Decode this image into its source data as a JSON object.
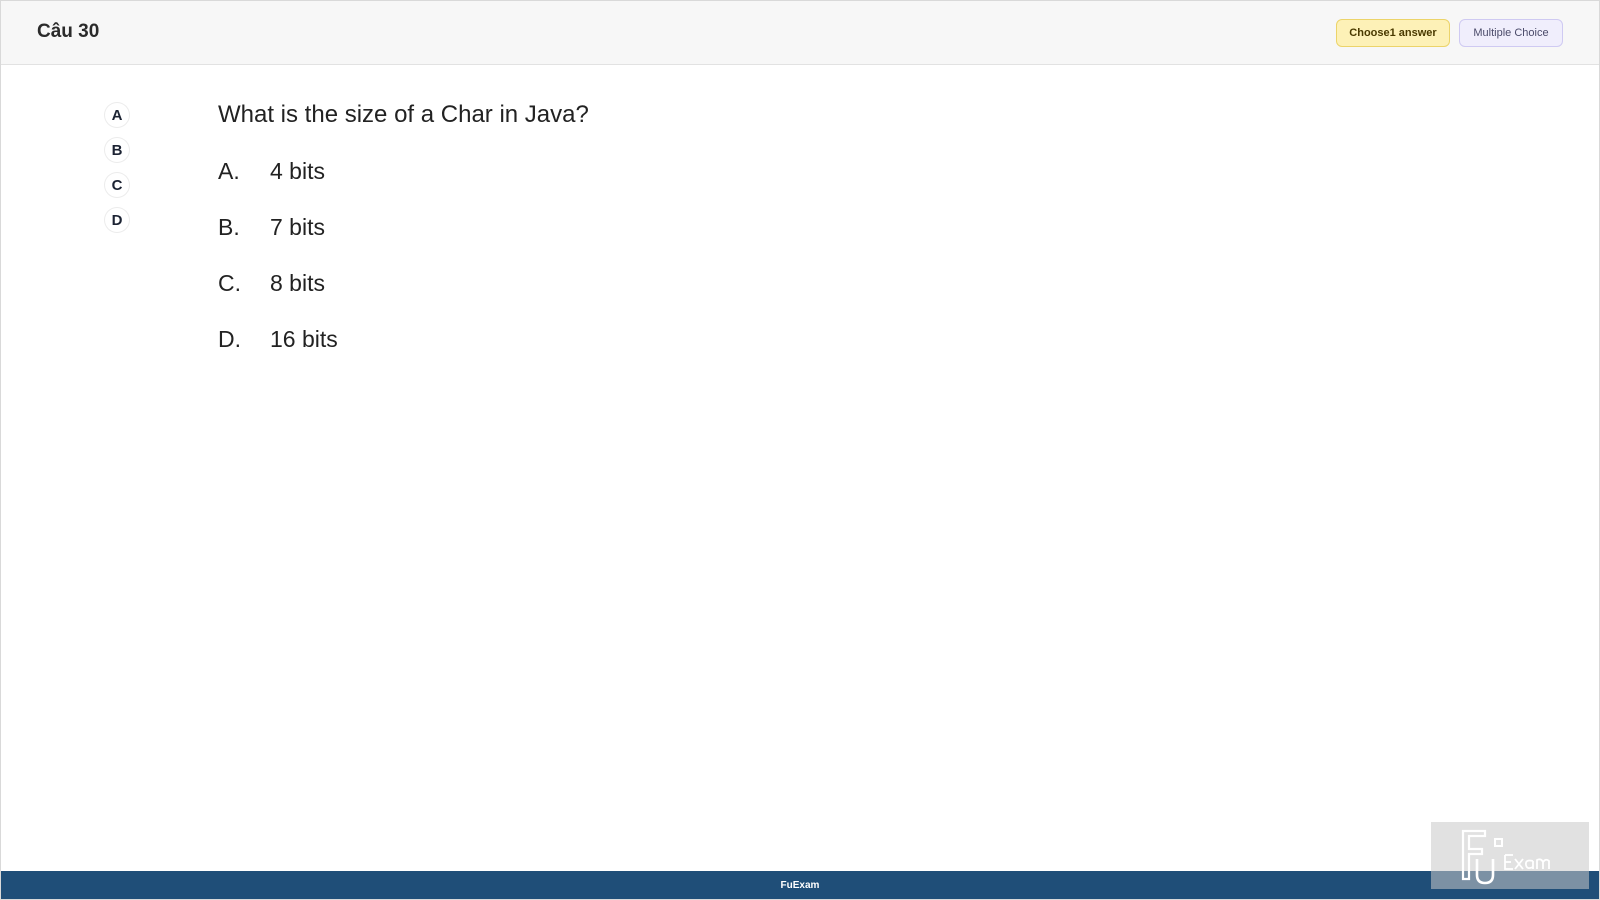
{
  "header": {
    "question_number": "Câu 30",
    "badge_choose": "Choose1 answer",
    "badge_type": "Multiple Choice"
  },
  "letter_nav": [
    "A",
    "B",
    "C",
    "D"
  ],
  "question": {
    "text": "What is the size of a Char in Java?",
    "options": [
      {
        "letter": "A.",
        "text": "4 bits"
      },
      {
        "letter": "B.",
        "text": "7 bits"
      },
      {
        "letter": "C.",
        "text": "8 bits"
      },
      {
        "letter": "D.",
        "text": "16 bits"
      }
    ]
  },
  "footer": {
    "brand": "FuExam"
  },
  "watermark": {
    "logo": "fu-exam-logo-icon"
  },
  "colors": {
    "footer_bg": "#1f4e78",
    "badge_choose_bg": "#fdf1b7",
    "badge_type_bg": "#f0eefc"
  }
}
